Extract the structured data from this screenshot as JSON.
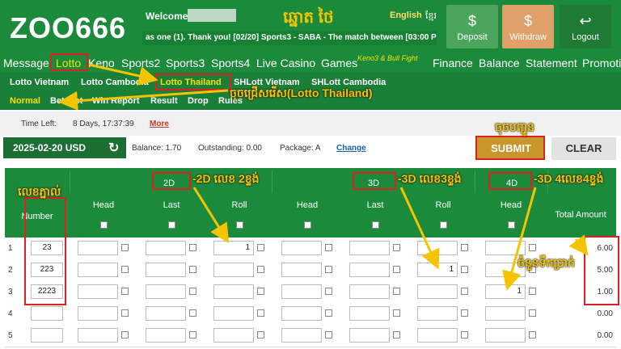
{
  "header": {
    "logo": "ZOO666",
    "welcome": "Welcome,",
    "khmer_title": "ឆ្នោត ថៃ",
    "lang_en": "English",
    "lang_kh": "ខ្មែរ",
    "marquee": "as one (1). Thank you!   [02/20] Sports3 - SABA - The match between [03:00 PM",
    "deposit": "Deposit",
    "withdraw": "Withdraw",
    "logout": "Logout"
  },
  "nav": [
    "Message",
    "Lotto",
    "Keno",
    "Sports2",
    "Sports3",
    "Sports4",
    "Live Casino",
    "Games",
    "Finance",
    "Balance",
    "Statement",
    "Promotio"
  ],
  "nav_badge": "Keno3 & Bull Fight",
  "subnav": [
    "Lotto Vietnam",
    "Lotto Cambodia",
    "Lotto Thailand",
    "SHLott Vietnam",
    "SHLott Cambodia"
  ],
  "subnav2": [
    "Normal",
    "Bet List",
    "Win Report",
    "Result",
    "Drop",
    "Rules"
  ],
  "info": {
    "time_left_label": "Time Left:",
    "time_left": "8 Days, 17:37:39",
    "more": "More"
  },
  "bar": {
    "date": "2025-02-20 USD",
    "balance": "Balance: 1.70",
    "outstanding": "Outstanding: 0.00",
    "package": "Package: A",
    "change": "Change",
    "submit": "SUBMIT",
    "clear": "CLEAR"
  },
  "table": {
    "number_header": "Number",
    "groups": [
      "2D",
      "3D",
      "4D"
    ],
    "col_head": "Head",
    "col_last": "Last",
    "col_roll": "Roll",
    "total_amount": "Total Amount",
    "rows": [
      {
        "no": "1",
        "number": "23",
        "roll2d": "1",
        "roll3d": "",
        "head4d": "",
        "amount": "6.00"
      },
      {
        "no": "2",
        "number": "223",
        "roll2d": "",
        "roll3d": "1",
        "head4d": "",
        "amount": "5.00"
      },
      {
        "no": "3",
        "number": "2223",
        "roll2d": "",
        "roll3d": "",
        "head4d": "1",
        "amount": "1.00"
      },
      {
        "no": "4",
        "number": "",
        "roll2d": "",
        "roll3d": "",
        "head4d": "",
        "amount": "0.00"
      },
      {
        "no": "5",
        "number": "",
        "roll2d": "",
        "roll3d": "",
        "head4d": "",
        "amount": "0.00"
      }
    ]
  },
  "annotations": {
    "select_thai": "ចុចជ្រើសរើស(Lotto Thailand)",
    "press_submit": "ចុចបញ្ជូន",
    "number_label": "លេខភ្នាល់",
    "ann_2d": "-2D លេខ 2ខ្ទង់",
    "ann_3d": "-3D លេខ3ខ្ទង់",
    "ann_4d": "-3D 4លេខ4ខ្ទង់",
    "total_money": "ចំនួនទឹកប្រាក់"
  }
}
